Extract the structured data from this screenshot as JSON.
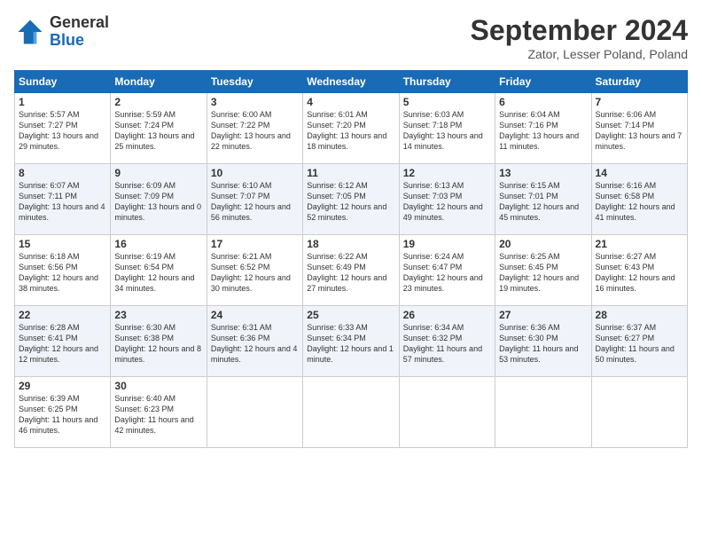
{
  "header": {
    "logo_general": "General",
    "logo_blue": "Blue",
    "month": "September 2024",
    "location": "Zator, Lesser Poland, Poland"
  },
  "weekdays": [
    "Sunday",
    "Monday",
    "Tuesday",
    "Wednesday",
    "Thursday",
    "Friday",
    "Saturday"
  ],
  "weeks": [
    [
      {
        "day": "1",
        "sunrise": "Sunrise: 5:57 AM",
        "sunset": "Sunset: 7:27 PM",
        "daylight": "Daylight: 13 hours and 29 minutes."
      },
      {
        "day": "2",
        "sunrise": "Sunrise: 5:59 AM",
        "sunset": "Sunset: 7:24 PM",
        "daylight": "Daylight: 13 hours and 25 minutes."
      },
      {
        "day": "3",
        "sunrise": "Sunrise: 6:00 AM",
        "sunset": "Sunset: 7:22 PM",
        "daylight": "Daylight: 13 hours and 22 minutes."
      },
      {
        "day": "4",
        "sunrise": "Sunrise: 6:01 AM",
        "sunset": "Sunset: 7:20 PM",
        "daylight": "Daylight: 13 hours and 18 minutes."
      },
      {
        "day": "5",
        "sunrise": "Sunrise: 6:03 AM",
        "sunset": "Sunset: 7:18 PM",
        "daylight": "Daylight: 13 hours and 14 minutes."
      },
      {
        "day": "6",
        "sunrise": "Sunrise: 6:04 AM",
        "sunset": "Sunset: 7:16 PM",
        "daylight": "Daylight: 13 hours and 11 minutes."
      },
      {
        "day": "7",
        "sunrise": "Sunrise: 6:06 AM",
        "sunset": "Sunset: 7:14 PM",
        "daylight": "Daylight: 13 hours and 7 minutes."
      }
    ],
    [
      {
        "day": "8",
        "sunrise": "Sunrise: 6:07 AM",
        "sunset": "Sunset: 7:11 PM",
        "daylight": "Daylight: 13 hours and 4 minutes."
      },
      {
        "day": "9",
        "sunrise": "Sunrise: 6:09 AM",
        "sunset": "Sunset: 7:09 PM",
        "daylight": "Daylight: 13 hours and 0 minutes."
      },
      {
        "day": "10",
        "sunrise": "Sunrise: 6:10 AM",
        "sunset": "Sunset: 7:07 PM",
        "daylight": "Daylight: 12 hours and 56 minutes."
      },
      {
        "day": "11",
        "sunrise": "Sunrise: 6:12 AM",
        "sunset": "Sunset: 7:05 PM",
        "daylight": "Daylight: 12 hours and 52 minutes."
      },
      {
        "day": "12",
        "sunrise": "Sunrise: 6:13 AM",
        "sunset": "Sunset: 7:03 PM",
        "daylight": "Daylight: 12 hours and 49 minutes."
      },
      {
        "day": "13",
        "sunrise": "Sunrise: 6:15 AM",
        "sunset": "Sunset: 7:01 PM",
        "daylight": "Daylight: 12 hours and 45 minutes."
      },
      {
        "day": "14",
        "sunrise": "Sunrise: 6:16 AM",
        "sunset": "Sunset: 6:58 PM",
        "daylight": "Daylight: 12 hours and 41 minutes."
      }
    ],
    [
      {
        "day": "15",
        "sunrise": "Sunrise: 6:18 AM",
        "sunset": "Sunset: 6:56 PM",
        "daylight": "Daylight: 12 hours and 38 minutes."
      },
      {
        "day": "16",
        "sunrise": "Sunrise: 6:19 AM",
        "sunset": "Sunset: 6:54 PM",
        "daylight": "Daylight: 12 hours and 34 minutes."
      },
      {
        "day": "17",
        "sunrise": "Sunrise: 6:21 AM",
        "sunset": "Sunset: 6:52 PM",
        "daylight": "Daylight: 12 hours and 30 minutes."
      },
      {
        "day": "18",
        "sunrise": "Sunrise: 6:22 AM",
        "sunset": "Sunset: 6:49 PM",
        "daylight": "Daylight: 12 hours and 27 minutes."
      },
      {
        "day": "19",
        "sunrise": "Sunrise: 6:24 AM",
        "sunset": "Sunset: 6:47 PM",
        "daylight": "Daylight: 12 hours and 23 minutes."
      },
      {
        "day": "20",
        "sunrise": "Sunrise: 6:25 AM",
        "sunset": "Sunset: 6:45 PM",
        "daylight": "Daylight: 12 hours and 19 minutes."
      },
      {
        "day": "21",
        "sunrise": "Sunrise: 6:27 AM",
        "sunset": "Sunset: 6:43 PM",
        "daylight": "Daylight: 12 hours and 16 minutes."
      }
    ],
    [
      {
        "day": "22",
        "sunrise": "Sunrise: 6:28 AM",
        "sunset": "Sunset: 6:41 PM",
        "daylight": "Daylight: 12 hours and 12 minutes."
      },
      {
        "day": "23",
        "sunrise": "Sunrise: 6:30 AM",
        "sunset": "Sunset: 6:38 PM",
        "daylight": "Daylight: 12 hours and 8 minutes."
      },
      {
        "day": "24",
        "sunrise": "Sunrise: 6:31 AM",
        "sunset": "Sunset: 6:36 PM",
        "daylight": "Daylight: 12 hours and 4 minutes."
      },
      {
        "day": "25",
        "sunrise": "Sunrise: 6:33 AM",
        "sunset": "Sunset: 6:34 PM",
        "daylight": "Daylight: 12 hours and 1 minute."
      },
      {
        "day": "26",
        "sunrise": "Sunrise: 6:34 AM",
        "sunset": "Sunset: 6:32 PM",
        "daylight": "Daylight: 11 hours and 57 minutes."
      },
      {
        "day": "27",
        "sunrise": "Sunrise: 6:36 AM",
        "sunset": "Sunset: 6:30 PM",
        "daylight": "Daylight: 11 hours and 53 minutes."
      },
      {
        "day": "28",
        "sunrise": "Sunrise: 6:37 AM",
        "sunset": "Sunset: 6:27 PM",
        "daylight": "Daylight: 11 hours and 50 minutes."
      }
    ],
    [
      {
        "day": "29",
        "sunrise": "Sunrise: 6:39 AM",
        "sunset": "Sunset: 6:25 PM",
        "daylight": "Daylight: 11 hours and 46 minutes."
      },
      {
        "day": "30",
        "sunrise": "Sunrise: 6:40 AM",
        "sunset": "Sunset: 6:23 PM",
        "daylight": "Daylight: 11 hours and 42 minutes."
      },
      null,
      null,
      null,
      null,
      null
    ]
  ]
}
